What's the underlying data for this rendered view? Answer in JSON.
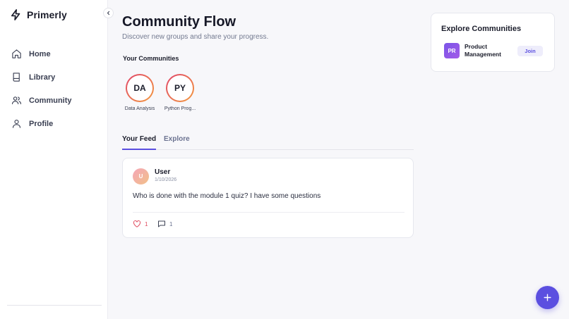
{
  "brand": {
    "name": "Primerly",
    "icon": "lightning-icon"
  },
  "colors": {
    "accent": "#5b4fe0",
    "like": "#e04a5e",
    "ring_start": "#e0466b",
    "ring_end": "#f39a3d"
  },
  "sidebar": {
    "collapse_icon": "chevron-left-icon",
    "items": [
      {
        "label": "Home",
        "icon": "home-icon"
      },
      {
        "label": "Library",
        "icon": "book-icon"
      },
      {
        "label": "Community",
        "icon": "users-icon"
      },
      {
        "label": "Profile",
        "icon": "user-icon"
      }
    ]
  },
  "header": {
    "title": "Community Flow",
    "subtitle": "Discover new groups and share your progress."
  },
  "your_communities": {
    "title": "Your Communities",
    "items": [
      {
        "initials": "DA",
        "name": "Data Analysis"
      },
      {
        "initials": "PY",
        "name": "Python Prog..."
      }
    ]
  },
  "tabs": [
    {
      "label": "Your Feed",
      "active": true
    },
    {
      "label": "Explore",
      "active": false
    }
  ],
  "feed": [
    {
      "avatar": "U",
      "author": "User",
      "date": "1/10/2026",
      "body": "Who is done with the module 1 quiz? I have some questions",
      "likes": "1",
      "comments": "1"
    }
  ],
  "explore_card": {
    "title": "Explore Communities",
    "items": [
      {
        "initials": "PR",
        "name": "Product Management",
        "button": "Join"
      }
    ]
  },
  "fab": {
    "icon": "plus-icon"
  }
}
